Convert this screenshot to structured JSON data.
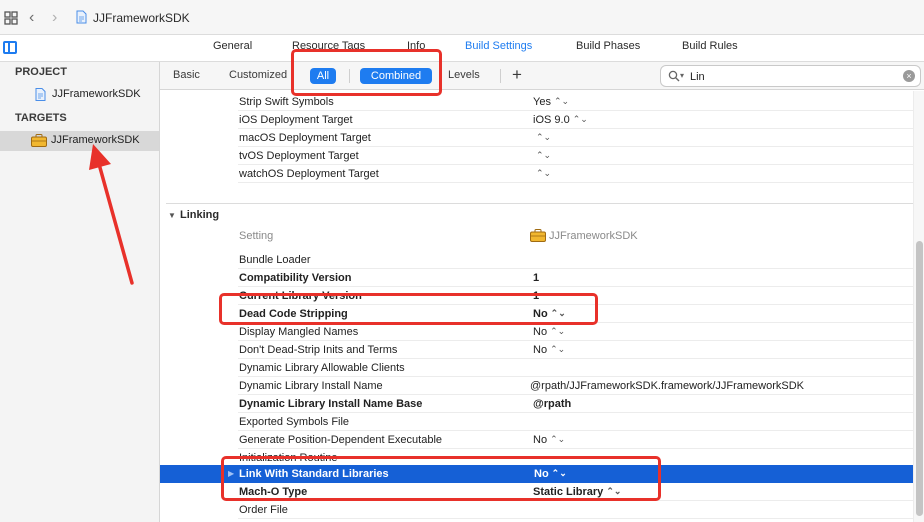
{
  "titlebar": {
    "title": "JJFrameworkSDK",
    "icons": [
      "grid-icon",
      "back-chevron-icon",
      "forward-chevron-icon",
      "swift-file-icon"
    ]
  },
  "tabs": [
    {
      "label": "General"
    },
    {
      "label": "Resource Tags"
    },
    {
      "label": "Info"
    },
    {
      "label": "Build Settings",
      "active": true
    },
    {
      "label": "Build Phases"
    },
    {
      "label": "Build Rules"
    }
  ],
  "sidebar": {
    "project_header": "PROJECT",
    "project_item": "JJFrameworkSDK",
    "targets_header": "TARGETS",
    "target_item": "JJFrameworkSDK"
  },
  "filterbar": {
    "basic": "Basic",
    "customized": "Customized",
    "all": "All",
    "combined": "Combined",
    "levels": "Levels",
    "add": "+",
    "search_value": "Lin",
    "clear": "×"
  },
  "prev_rows": [
    {
      "name": "Strip Swift Symbols",
      "value": "Yes"
    },
    {
      "name": "iOS Deployment Target",
      "value": "iOS 9.0"
    },
    {
      "name": "macOS Deployment Target",
      "value": ""
    },
    {
      "name": "tvOS Deployment Target",
      "value": ""
    },
    {
      "name": "watchOS Deployment Target",
      "value": ""
    }
  ],
  "linking": {
    "section_title": "Linking",
    "header_setting": "Setting",
    "header_target": "JJFrameworkSDK",
    "rows": [
      {
        "name": "Bundle Loader",
        "value": ""
      },
      {
        "name": "Compatibility Version",
        "value": "1"
      },
      {
        "name": "Current Library Version",
        "value": "1"
      },
      {
        "name": "Dead Code Stripping",
        "value": "No"
      },
      {
        "name": "Display Mangled Names",
        "value": "No"
      },
      {
        "name": "Don't Dead-Strip Inits and Terms",
        "value": "No"
      },
      {
        "name": "Dynamic Library Allowable Clients",
        "value": ""
      },
      {
        "name": "Dynamic Library Install Name",
        "value": "@rpath/JJFrameworkSDK.framework/JJFrameworkSDK"
      },
      {
        "name": "Dynamic Library Install Name Base",
        "value": "@rpath"
      },
      {
        "name": "Exported Symbols File",
        "value": ""
      },
      {
        "name": "Generate Position-Dependent Executable",
        "value": "No"
      },
      {
        "name": "Initialization Routine",
        "value": ""
      },
      {
        "name": "Link With Standard Libraries",
        "value": "No"
      },
      {
        "name": "Mach-O Type",
        "value": "Static Library"
      },
      {
        "name": "Order File",
        "value": ""
      }
    ]
  },
  "colors": {
    "accent": "#1e7cf0",
    "selection": "#1560d6",
    "annotation": "#e8312a"
  }
}
